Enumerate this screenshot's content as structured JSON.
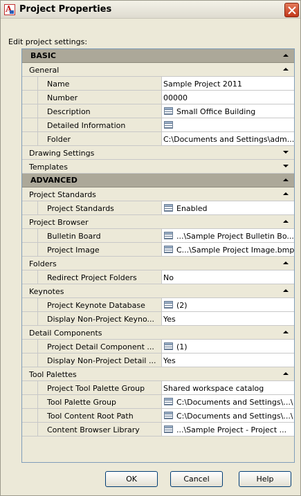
{
  "window": {
    "title": "Project Properties",
    "intro": "Edit project settings:",
    "close_symbol": "×"
  },
  "sections": [
    {
      "label": "BASIC",
      "categories": [
        {
          "label": "General",
          "expanded": true,
          "props": [
            {
              "name": "Name",
              "value": "Sample Project 2011",
              "icon": false
            },
            {
              "name": "Number",
              "value": "00000",
              "icon": false
            },
            {
              "name": "Description",
              "value": "Small Office Building",
              "icon": true
            },
            {
              "name": "Detailed Information",
              "value": "",
              "icon": true
            },
            {
              "name": "Folder",
              "value": "C:\\Documents and Settings\\adm...",
              "icon": false
            }
          ]
        },
        {
          "label": "Drawing Settings",
          "expanded": false,
          "props": []
        },
        {
          "label": "Templates",
          "expanded": false,
          "props": []
        }
      ]
    },
    {
      "label": "ADVANCED",
      "categories": [
        {
          "label": "Project Standards",
          "expanded": true,
          "props": [
            {
              "name": "Project Standards",
              "value": "Enabled",
              "icon": true
            }
          ]
        },
        {
          "label": "Project Browser",
          "expanded": true,
          "props": [
            {
              "name": "Bulletin Board",
              "value": "...\\Sample Project Bulletin Bo...",
              "icon": true
            },
            {
              "name": "Project Image",
              "value": "C...\\Sample Project Image.bmp",
              "icon": true
            }
          ]
        },
        {
          "label": "Folders",
          "expanded": true,
          "props": [
            {
              "name": "Redirect Project Folders",
              "value": "No",
              "icon": false
            }
          ]
        },
        {
          "label": "Keynotes",
          "expanded": true,
          "props": [
            {
              "name": "Project Keynote Database",
              "value": "(2)",
              "icon": true
            },
            {
              "name": "Display Non-Project Keyno...",
              "value": "Yes",
              "icon": false
            }
          ]
        },
        {
          "label": "Detail Components",
          "expanded": true,
          "props": [
            {
              "name": "Project Detail Component ...",
              "value": "(1)",
              "icon": true
            },
            {
              "name": "Display Non-Project Detail ...",
              "value": "Yes",
              "icon": false
            }
          ]
        },
        {
          "label": "Tool Palettes",
          "expanded": true,
          "props": [
            {
              "name": "Project Tool Palette Group",
              "value": "Shared workspace catalog",
              "icon": false
            },
            {
              "name": "Tool Palette Group",
              "value": "C:\\Documents and Settings\\...\\",
              "icon": true
            },
            {
              "name": "Tool Content Root Path",
              "value": "C:\\Documents and Settings\\...\\",
              "icon": true
            },
            {
              "name": "Content Browser Library",
              "value": "...\\Sample Project - Project ...",
              "icon": true
            }
          ]
        }
      ]
    }
  ],
  "buttons": {
    "ok": "OK",
    "cancel": "Cancel",
    "help": "Help"
  },
  "colors": {
    "section_bg": "#aca899",
    "dialog_bg": "#ece9d8",
    "close_red": "#c2361a"
  }
}
